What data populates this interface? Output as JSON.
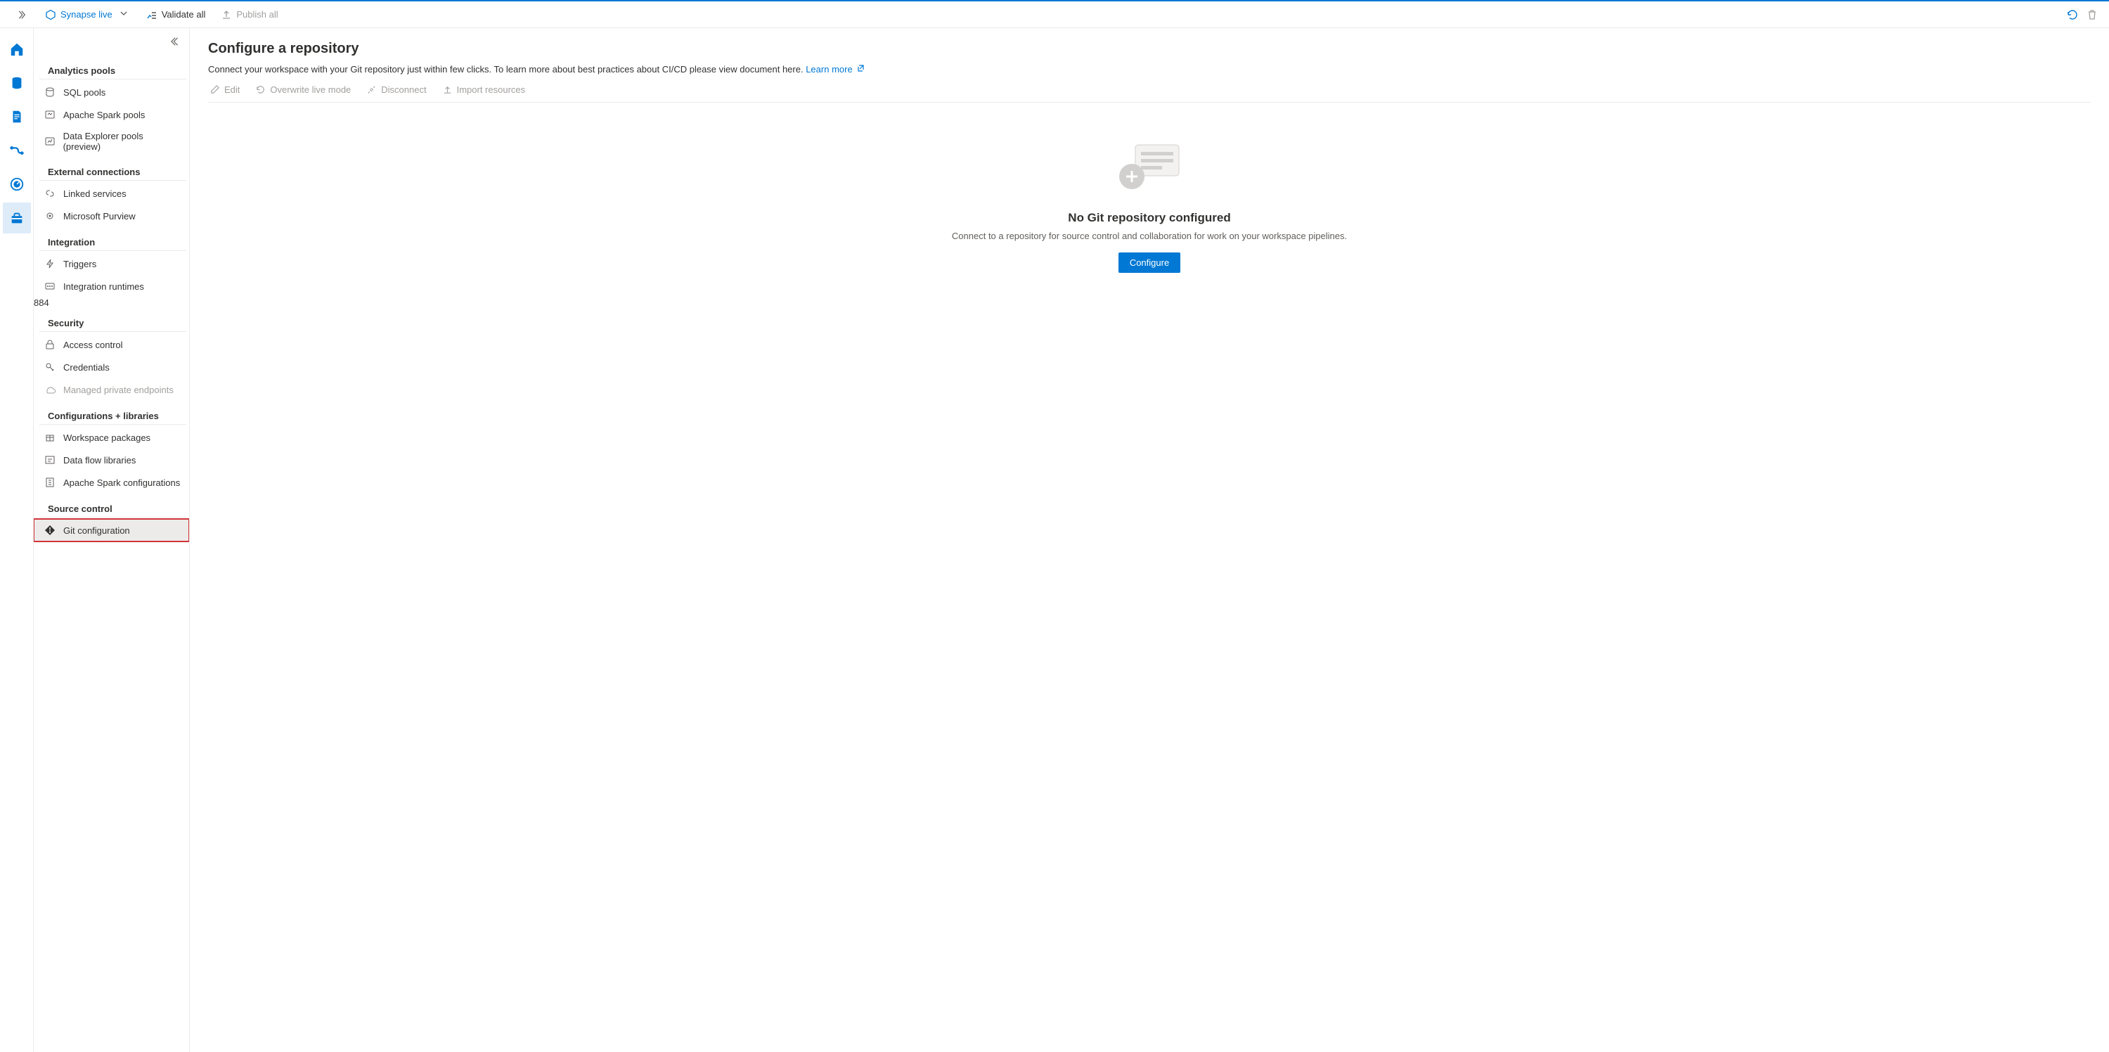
{
  "topbar": {
    "mode_label": "Synapse live",
    "validate_label": "Validate all",
    "publish_label": "Publish all"
  },
  "sidebar": {
    "sections": [
      {
        "title": "Analytics pools",
        "items": [
          {
            "label": "SQL pools"
          },
          {
            "label": "Apache Spark pools"
          },
          {
            "label": "Data Explorer pools (preview)"
          }
        ]
      },
      {
        "title": "External connections",
        "items": [
          {
            "label": "Linked services"
          },
          {
            "label": "Microsoft Purview"
          }
        ]
      },
      {
        "title": "Integration",
        "items": [
          {
            "label": "Triggers"
          },
          {
            "label": "Integration runtimes"
          }
        ]
      },
      {
        "title": "Security",
        "items": [
          {
            "label": "Access control"
          },
          {
            "label": "Credentials"
          },
          {
            "label": "Managed private endpoints",
            "disabled": true
          }
        ]
      },
      {
        "title": "Configurations + libraries",
        "items": [
          {
            "label": "Workspace packages"
          },
          {
            "label": "Data flow libraries"
          },
          {
            "label": "Apache Spark configurations"
          }
        ]
      },
      {
        "title": "Source control",
        "items": [
          {
            "label": "Git configuration",
            "selected": true
          }
        ]
      }
    ]
  },
  "main": {
    "title": "Configure a repository",
    "subtitle_text": "Connect your workspace with your Git repository just within few clicks. To learn more about best practices about CI/CD please view document here. ",
    "learn_more": "Learn more",
    "commands": {
      "edit": "Edit",
      "overwrite": "Overwrite live mode",
      "disconnect": "Disconnect",
      "import": "Import resources"
    },
    "empty": {
      "heading": "No Git repository configured",
      "body": "Connect to a repository for source control and collaboration for work on your workspace pipelines.",
      "button": "Configure"
    }
  }
}
